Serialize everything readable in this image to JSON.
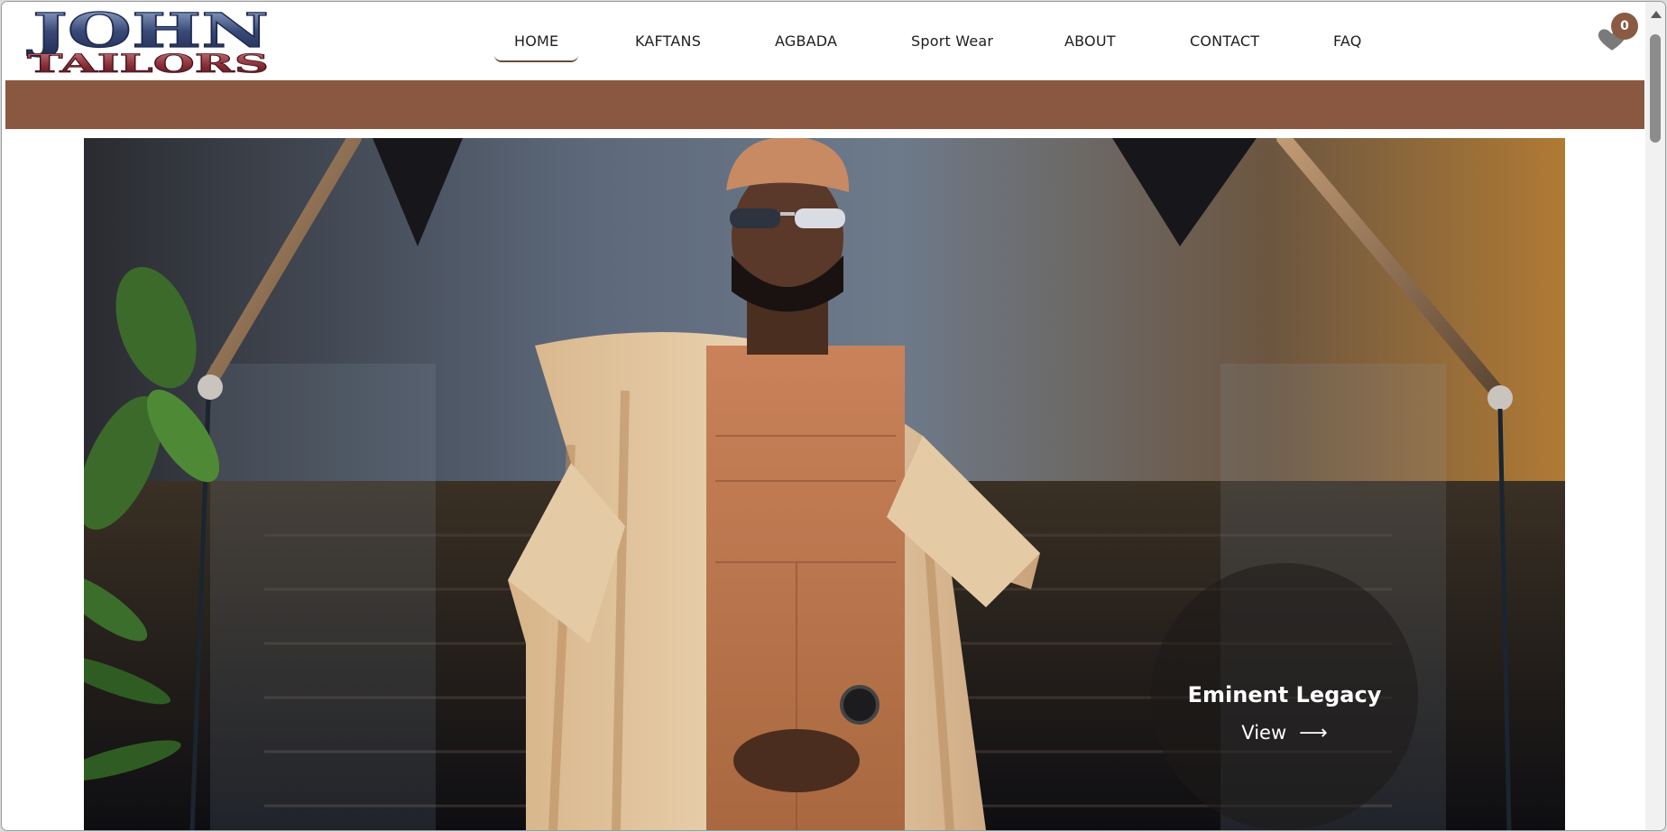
{
  "brand": {
    "logo_line1": "JOHN",
    "logo_line2": "TAILORS"
  },
  "nav": {
    "items": [
      {
        "label": "HOME",
        "active": true
      },
      {
        "label": "KAFTANS",
        "active": false
      },
      {
        "label": "AGBADA",
        "active": false
      },
      {
        "label": "Sport Wear",
        "active": false
      },
      {
        "label": "ABOUT",
        "active": false
      },
      {
        "label": "CONTACT",
        "active": false
      },
      {
        "label": "FAQ",
        "active": false
      }
    ]
  },
  "cart": {
    "icon": "heart-icon",
    "count": "0"
  },
  "hero": {
    "title": "Eminent Legacy",
    "link_label": "View",
    "link_arrow": "⟶"
  },
  "colors": {
    "brand_brown": "#8a5740",
    "badge_brown": "#8a5a43",
    "logo_blue": "#3a4a78",
    "logo_red": "#8a2f38"
  }
}
